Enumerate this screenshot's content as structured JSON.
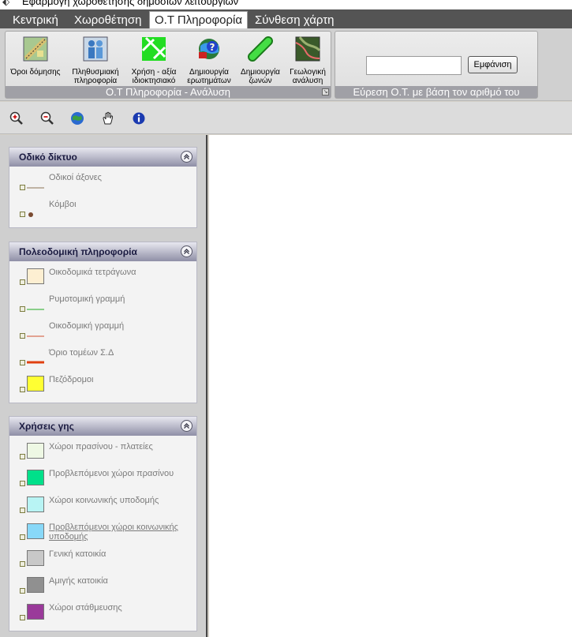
{
  "window": {
    "title": "Εφαρμογή χωροθέτησης δημοσίων λειτουργιών"
  },
  "tabs": [
    {
      "label": "Κεντρική"
    },
    {
      "label": "Χωροθέτηση"
    },
    {
      "label": "Ο.Τ Πληροφορία"
    },
    {
      "label": "Σύνθεση χάρτη"
    }
  ],
  "ribbon": {
    "group_analysis": {
      "footer": "Ο.Τ Πληροφορία - Ανάλυση",
      "buttons": [
        {
          "label": "Όροι δόμησης",
          "icon": "building-terms-icon"
        },
        {
          "label": "Πληθυσμιακή πληροφορία",
          "icon": "population-icon"
        },
        {
          "label": "Χρήση - αξία ιδιοκτησιακό",
          "icon": "land-use-value-icon"
        },
        {
          "label": "Δημιουργία ερωτημάτων",
          "icon": "query-globe-icon"
        },
        {
          "label": "Δημιουργία ζωνών",
          "icon": "zone-buffer-icon"
        },
        {
          "label": "Γεωλογική ανάλυση",
          "icon": "geology-map-icon"
        }
      ]
    },
    "group_search": {
      "footer": "Εύρεση Ο.Τ. με βάση τον αριθμό του",
      "input_value": "",
      "button_label": "Εμφάνιση"
    }
  },
  "toolbar": [
    "zoom-in-icon",
    "zoom-out-icon",
    "globe-full-extent-icon",
    "pan-hand-icon",
    "info-icon"
  ],
  "panels": [
    {
      "title": "Οδικό δίκτυο",
      "items": [
        {
          "label": "Οδικοί άξονες",
          "symbol": "line",
          "color": "#8b7355"
        },
        {
          "label": "Κόμβοι",
          "symbol": "dot",
          "color": "#7a4a30"
        }
      ]
    },
    {
      "title": "Πολεοδομική πληροφορία",
      "items": [
        {
          "label": "Οικοδομικά τετράγωνα",
          "symbol": "box",
          "color": "#fdefd2"
        },
        {
          "label": "Ρυμοτομική γραμμή",
          "symbol": "line",
          "color": "#22aa22"
        },
        {
          "label": "Οικοδομική γραμμή",
          "symbol": "line",
          "color": "#d05030"
        },
        {
          "label": "Όριο τομέων Σ.Δ",
          "symbol": "thickline",
          "color": "#e04010"
        },
        {
          "label": "Πεζόδρομοι",
          "symbol": "box",
          "color": "#ffff33"
        }
      ]
    },
    {
      "title": "Χρήσεις γης",
      "items": [
        {
          "label": "Χώροι πρασίνου - πλατείες",
          "symbol": "box",
          "color": "#eef8e4"
        },
        {
          "label": "Προβλεπόμενοι χώροι πρασίνου",
          "symbol": "box",
          "color": "#00e08a"
        },
        {
          "label": "Χώροι κοινωνικής υποδομής",
          "symbol": "box",
          "color": "#b8f4f4"
        },
        {
          "label": "Προβλεπόμενοι χώροι κοινωνικής υποδομής",
          "symbol": "box",
          "color": "#88d8f8"
        },
        {
          "label": "Γενική κατοικία",
          "symbol": "box",
          "color": "#c8c8c8"
        },
        {
          "label": "Αμιγής κατοικία",
          "symbol": "box",
          "color": "#909090"
        },
        {
          "label": "Χώροι στάθμευσης",
          "symbol": "box",
          "color": "#9a3a9a"
        }
      ]
    }
  ]
}
